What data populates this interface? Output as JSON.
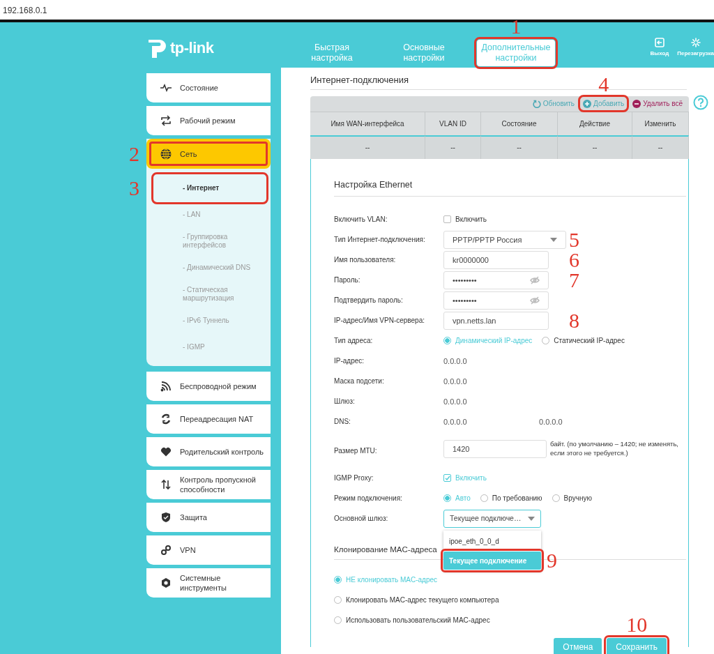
{
  "address_bar": {
    "url": "192.168.0.1"
  },
  "header": {
    "logo": "tp-link",
    "tabs": [
      {
        "label": "Быстрая настройка",
        "selected": false
      },
      {
        "label": "Основные настройки",
        "selected": false
      },
      {
        "label": "Дополнительные настройки",
        "selected": true,
        "annotation": "1"
      }
    ],
    "actions": [
      {
        "label": "Выход",
        "kind": "logout"
      },
      {
        "label": "Перезагрузка",
        "kind": "reboot"
      }
    ]
  },
  "sidebar": {
    "items": [
      {
        "label": "Состояние",
        "kind": "status",
        "selected": false
      },
      {
        "label": "Рабочий режим",
        "kind": "mode",
        "selected": false
      },
      {
        "label": "Сеть",
        "kind": "network",
        "selected": true,
        "annotation": "2",
        "children": [
          {
            "label": "- Интернет",
            "selected": true,
            "annotation": "3"
          },
          {
            "label": "- LAN",
            "selected": false
          },
          {
            "label": "- Группировка интерфейсов",
            "selected": false
          },
          {
            "label": "- Динамический DNS",
            "selected": false
          },
          {
            "label": "- Статическая маршрутизация",
            "selected": false
          },
          {
            "label": "- IPv6 Туннель",
            "selected": false
          },
          {
            "label": "- IGMP",
            "selected": false
          }
        ]
      },
      {
        "label": "Беспроводной режим",
        "kind": "wireless",
        "selected": false
      },
      {
        "label": "Переадресация NAT",
        "kind": "nat",
        "selected": false
      },
      {
        "label": "Родительский контроль",
        "kind": "parental",
        "selected": false
      },
      {
        "label": "Контроль пропускной способности",
        "kind": "bandwidth",
        "selected": false
      },
      {
        "label": "Защита",
        "kind": "security",
        "selected": false
      },
      {
        "label": "VPN",
        "kind": "vpn",
        "selected": false
      },
      {
        "label": "Системные инструменты",
        "kind": "system",
        "selected": false
      }
    ]
  },
  "main": {
    "title": "Интернет-подключения",
    "toolbar": [
      {
        "label": "Обновить",
        "kind": "refresh"
      },
      {
        "label": "Добавить",
        "kind": "add",
        "annotation": "4"
      },
      {
        "label": "Удалить всё",
        "kind": "delete"
      }
    ],
    "table": {
      "columns": [
        "Имя WAN-интерфейса",
        "VLAN ID",
        "Состояние",
        "Действие",
        "Изменить"
      ],
      "rows": [
        [
          "--",
          "--",
          "--",
          "--",
          "--"
        ]
      ]
    },
    "form": {
      "title": "Настройка Ethernet",
      "rows": [
        {
          "kind": "checkbox",
          "label": "Включить VLAN:",
          "option": "Включить",
          "checked": false
        },
        {
          "kind": "select",
          "label": "Тип Интернет-подключения:",
          "value": "PPTP/PPTP Россия",
          "annotation": "5"
        },
        {
          "kind": "input",
          "label": "Имя пользователя:",
          "value": "kr0000000",
          "annotation": "6"
        },
        {
          "kind": "password",
          "label": "Пароль:",
          "value": "•••••••••",
          "annotation": "7"
        },
        {
          "kind": "password",
          "label": "Подтвердить пароль:",
          "value": "•••••••••"
        },
        {
          "kind": "input",
          "label": "IP-адрес/Имя VPN-сервера:",
          "value": "vpn.netts.lan",
          "annotation": "8"
        },
        {
          "kind": "radio",
          "label": "Тип адреса:",
          "options": [
            {
              "label": "Динамический IP-адрес",
              "selected": true
            },
            {
              "label": "Статический IP-адрес",
              "selected": false
            }
          ]
        },
        {
          "kind": "text",
          "label": "IP-адрес:",
          "values": [
            "0.0.0.0"
          ]
        },
        {
          "kind": "text",
          "label": "Маска подсети:",
          "values": [
            "0.0.0.0"
          ]
        },
        {
          "kind": "text",
          "label": "Шлюз:",
          "values": [
            "0.0.0.0"
          ]
        },
        {
          "kind": "text",
          "label": "DNS:",
          "values": [
            "0.0.0.0",
            "0.0.0.0"
          ]
        },
        {
          "kind": "input",
          "label": "Размер MTU:",
          "value": "1420",
          "note": "байт. (по умолчанию – 1420; не изменять, если этого не требуется.)"
        },
        {
          "kind": "checkbox",
          "label": "IGMP Proxy:",
          "option": "Включить",
          "checked": true
        },
        {
          "kind": "radio",
          "label": "Режим подключения:",
          "options": [
            {
              "label": "Авто",
              "selected": true
            },
            {
              "label": "По требованию",
              "selected": false
            },
            {
              "label": "Вручную",
              "selected": false
            }
          ]
        },
        {
          "kind": "select",
          "label": "Основной шлюз:",
          "value": "Текущее подключе…",
          "expanded": true,
          "options": [
            {
              "label": "ipoe_eth_0_0_d",
              "selected": false
            },
            {
              "label": "Текущее подключение",
              "selected": true,
              "annotation": "9"
            }
          ]
        }
      ]
    },
    "mac": {
      "title": "Клонирование MAC-адреса",
      "options": [
        {
          "label": "НЕ клонировать MAC-адрес",
          "selected": true
        },
        {
          "label": "Клонировать MAC-адрес текущего компьютера",
          "selected": false
        },
        {
          "label": "Использовать пользовательский MAC-адрес",
          "selected": false
        }
      ]
    },
    "buttons": [
      {
        "label": "Отмена"
      },
      {
        "label": "Сохранить",
        "annotation": "10"
      }
    ]
  }
}
